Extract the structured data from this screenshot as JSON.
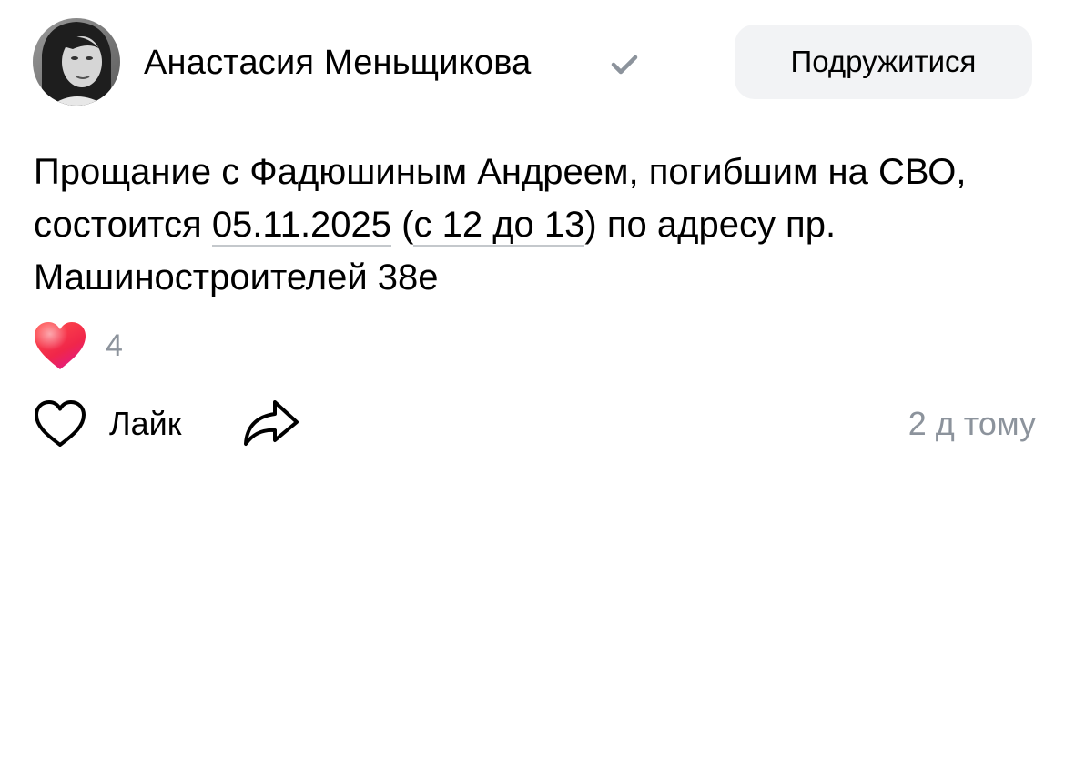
{
  "author": {
    "name": "Анастасия Меньщикова",
    "verified_icon": "checkmark-icon"
  },
  "header": {
    "friend_button_label": "Подружитися"
  },
  "post": {
    "text_part1": "Прощание с Фадюшиным Андреем, погибшим на СВО, состоится ",
    "date_link": "05.11.2025",
    "text_part2": " (",
    "time_link": "с 12 до 13",
    "text_part3": ") по адресу пр. Машиностроителей 38е"
  },
  "reactions": {
    "icon": "heart-reaction-icon",
    "count": "4"
  },
  "actions": {
    "like_label": "Лайк",
    "like_icon": "heart-outline-icon",
    "share_icon": "share-arrow-icon",
    "timestamp": "2 д тому"
  },
  "colors": {
    "secondary_text": "#8c939c",
    "button_bg": "#f2f3f5",
    "heart_red": "#ff3347"
  }
}
